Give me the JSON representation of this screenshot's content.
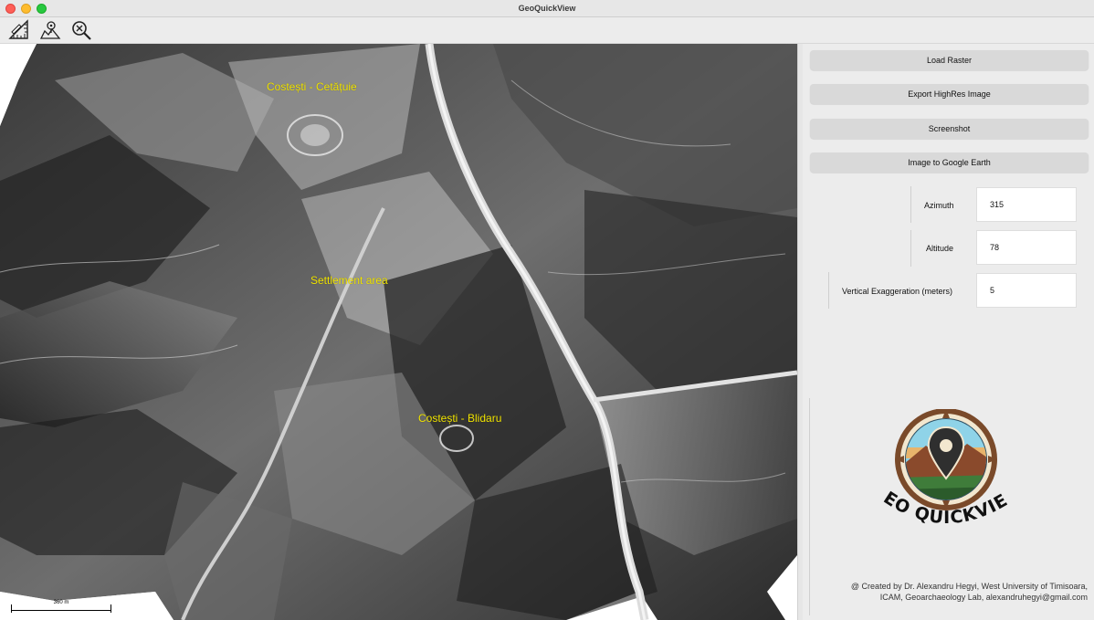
{
  "window": {
    "title": "GeoQuickView"
  },
  "toolbar": {
    "tools": [
      {
        "icon": "ruler-icon"
      },
      {
        "icon": "map-profile-icon"
      },
      {
        "icon": "zoom-reset-icon"
      }
    ]
  },
  "map": {
    "labels": {
      "site1": "Costești - Cetățuie",
      "site2": "Settlement area",
      "site3": "Costești - Blidaru"
    },
    "label_color": "#f1e400",
    "scalebar_text": "360 m"
  },
  "panel": {
    "buttons": {
      "load_raster": "Load Raster",
      "export_highres": "Export HighRes Image",
      "screenshot": "Screenshot",
      "google_earth": "Image to Google Earth"
    },
    "params": {
      "azimuth_label": "Azimuth",
      "azimuth_value": "315",
      "altitude_label": "Altitude",
      "altitude_value": "78",
      "vexag_label": "Vertical Exaggeration (meters)",
      "vexag_value": "5"
    },
    "logo_text": "GEO QUICKVIEW",
    "credit_line1": "@ Created by Dr. Alexandru Hegyi, West University of Timisoara,",
    "credit_line2": "ICAM, Geoarchaeology Lab, alexandruhegyi@gmail.com"
  }
}
